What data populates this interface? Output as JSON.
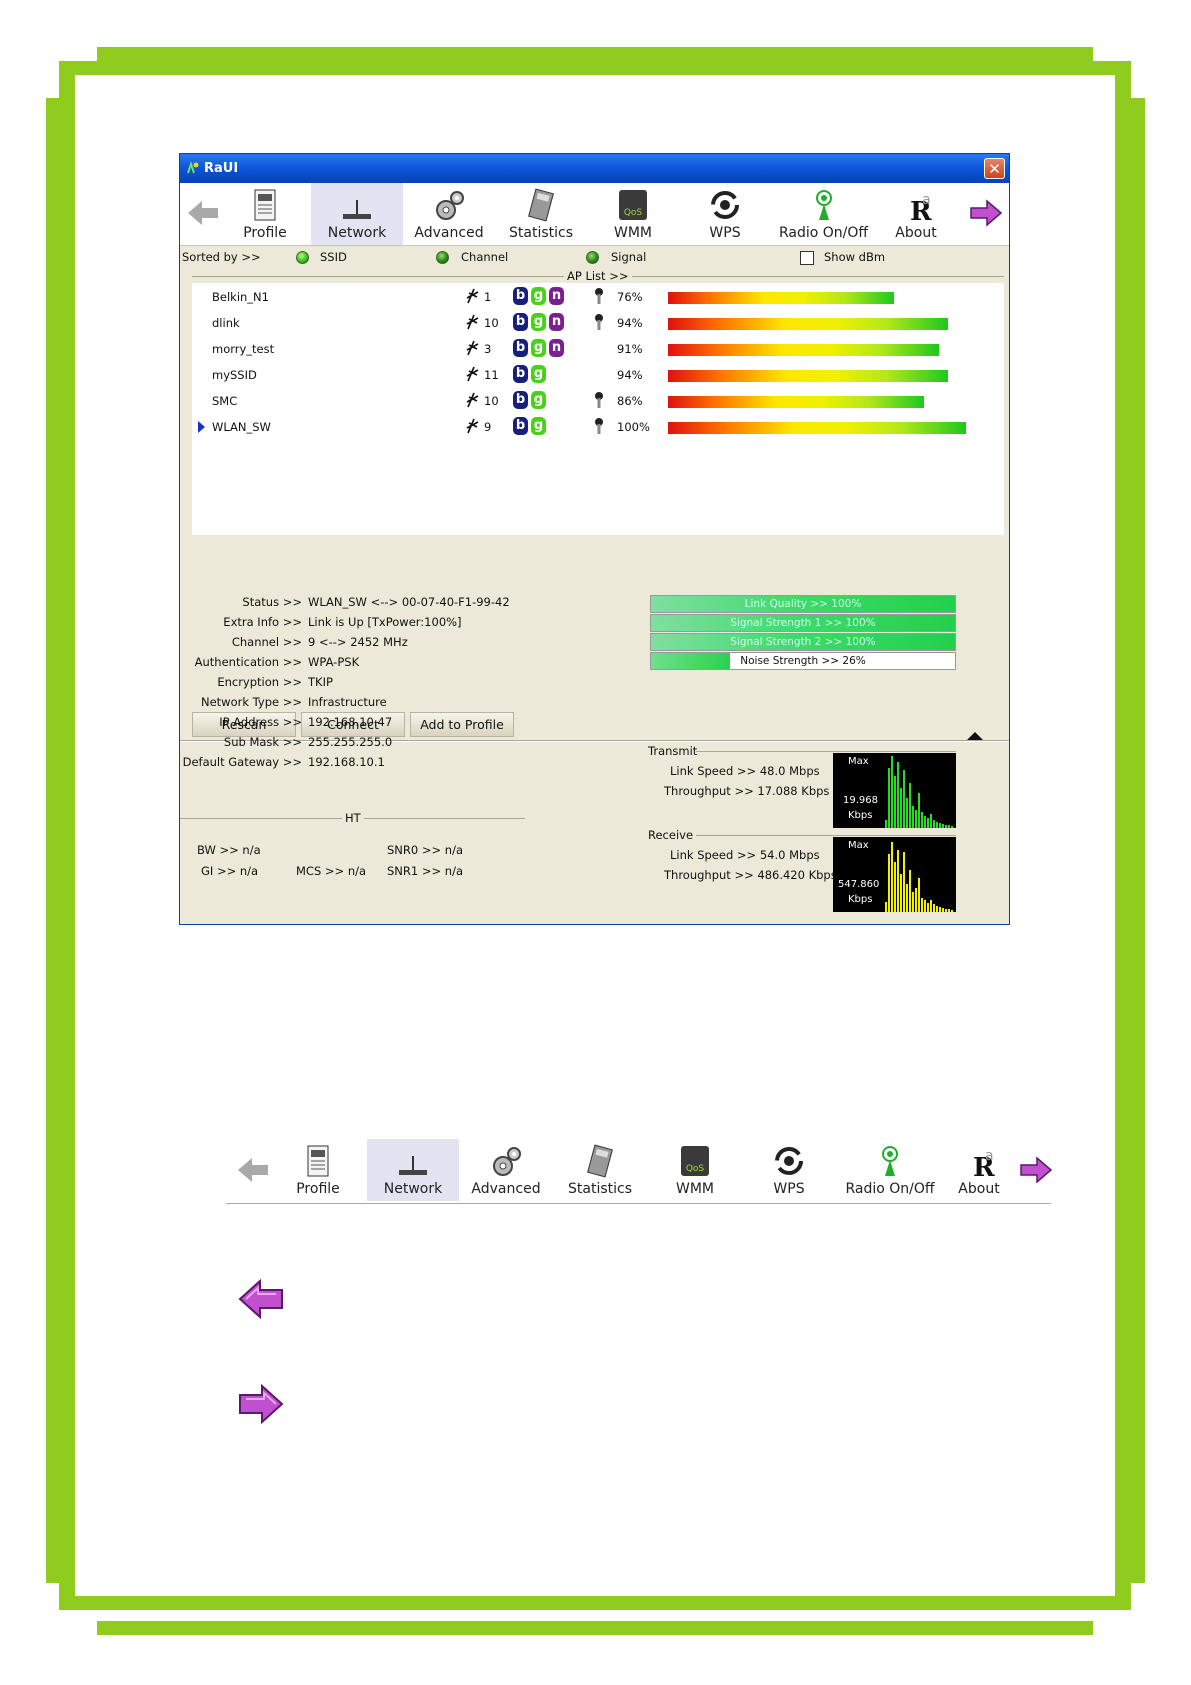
{
  "window": {
    "title": "RaUI",
    "close_label": "✕"
  },
  "toolbar": {
    "items": [
      {
        "label": "Profile",
        "icon": "profile-icon"
      },
      {
        "label": "Network",
        "icon": "network-icon"
      },
      {
        "label": "Advanced",
        "icon": "advanced-icon"
      },
      {
        "label": "Statistics",
        "icon": "statistics-icon"
      },
      {
        "label": "WMM",
        "icon": "wmm-qos-icon"
      },
      {
        "label": "WPS",
        "icon": "wps-icon"
      },
      {
        "label": "Radio On/Off",
        "icon": "radio-icon"
      },
      {
        "label": "About",
        "icon": "about-icon"
      }
    ],
    "active": "Network"
  },
  "survey": {
    "sorted_by_label": "Sorted by >>",
    "sort_options": [
      "SSID",
      "Channel",
      "Signal"
    ],
    "show_dbm_label": "Show dBm",
    "ap_list_title": "AP List >>",
    "aps": [
      {
        "ssid": "Belkin_N1",
        "channel": "1",
        "modes": [
          "b",
          "g",
          "n"
        ],
        "secure": true,
        "signal_text": "76%",
        "signal": 76
      },
      {
        "ssid": "dlink",
        "channel": "10",
        "modes": [
          "b",
          "g",
          "n"
        ],
        "secure": true,
        "signal_text": "94%",
        "signal": 94
      },
      {
        "ssid": "morry_test",
        "channel": "3",
        "modes": [
          "b",
          "g",
          "n"
        ],
        "secure": false,
        "signal_text": "91%",
        "signal": 91
      },
      {
        "ssid": "mySSID",
        "channel": "11",
        "modes": [
          "b",
          "g"
        ],
        "secure": false,
        "signal_text": "94%",
        "signal": 94
      },
      {
        "ssid": "SMC",
        "channel": "10",
        "modes": [
          "b",
          "g"
        ],
        "secure": true,
        "signal_text": "86%",
        "signal": 86
      },
      {
        "ssid": "WLAN_SW",
        "channel": "9",
        "modes": [
          "b",
          "g"
        ],
        "secure": true,
        "signal_text": "100%",
        "signal": 100
      }
    ],
    "selected": "WLAN_SW",
    "buttons": {
      "rescan": "Rescan",
      "connect": "Connect",
      "add_profile": "Add to Profile"
    }
  },
  "status": {
    "rows": [
      {
        "label": "Status >>",
        "value": "WLAN_SW <--> 00-07-40-F1-99-42"
      },
      {
        "label": "Extra Info >>",
        "value": "Link is Up [TxPower:100%]"
      },
      {
        "label": "Channel >>",
        "value": "9 <--> 2452 MHz"
      },
      {
        "label": "Authentication >>",
        "value": "WPA-PSK"
      },
      {
        "label": "Encryption >>",
        "value": "TKIP"
      },
      {
        "label": "Network Type >>",
        "value": "Infrastructure"
      },
      {
        "label": "IP Address >>",
        "value": "192.168.10.47"
      },
      {
        "label": "Sub Mask >>",
        "value": "255.255.255.0"
      },
      {
        "label": "Default Gateway >>",
        "value": "192.168.10.1"
      }
    ],
    "ht_title": "HT",
    "ht": {
      "bw": "BW >> n/a",
      "gi": "GI >> n/a",
      "mcs": "MCS >> n/a",
      "snr0": "SNR0 >> n/a",
      "snr1": "SNR1 >> n/a"
    },
    "meters": [
      {
        "text": "Link Quality >> 100%",
        "value": 100
      },
      {
        "text": "Signal Strength 1 >> 100%",
        "value": 100
      },
      {
        "text": "Signal Strength 2 >> 100%",
        "value": 100
      },
      {
        "text": "Noise Strength >> 26%",
        "value": 26
      }
    ],
    "transmit": {
      "title": "Transmit",
      "link_speed": "Link Speed >> 48.0 Mbps",
      "throughput": "Throughput >> 17.088 Kbps",
      "graph_max": "Max",
      "graph_value": "19.968",
      "graph_unit": "Kbps",
      "graph_color": "#22dd22"
    },
    "receive": {
      "title": "Receive",
      "link_speed": "Link Speed >> 54.0 Mbps",
      "throughput": "Throughput >> 486.420 Kbps",
      "graph_max": "Max",
      "graph_value": "547.860",
      "graph_unit": "Kbps",
      "graph_color": "#f0f000"
    }
  },
  "doc_toolbar": {
    "items": [
      "Profile",
      "Network",
      "Advanced",
      "Statistics",
      "WMM",
      "WPS",
      "Radio On/Off",
      "About"
    ],
    "active": "Network"
  },
  "colors": {
    "page_border": "#8fcc1e",
    "title_bar": "#0a52d6",
    "window_bg": "#ece9d8",
    "nav_arrow": "#c050d0"
  }
}
